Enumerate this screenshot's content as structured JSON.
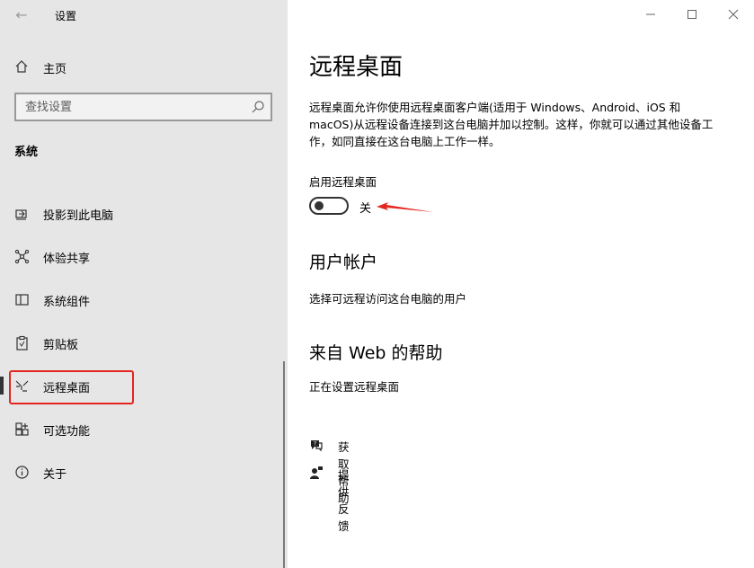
{
  "window": {
    "title": "设置",
    "back_glyph": "←",
    "controls": [
      "minimize-icon",
      "maximize-icon",
      "close-icon"
    ]
  },
  "sidebar": {
    "home_label": "主页",
    "search_placeholder": "查找设置",
    "section": "系统",
    "items": [
      {
        "label": "投影到此电脑",
        "icon": "projector-icon"
      },
      {
        "label": "体验共享",
        "icon": "share-icon"
      },
      {
        "label": "系统组件",
        "icon": "components-icon"
      },
      {
        "label": "剪贴板",
        "icon": "clipboard-icon"
      },
      {
        "label": "远程桌面",
        "icon": "remote-desktop-icon",
        "selected": true
      },
      {
        "label": "可选功能",
        "icon": "optional-features-icon"
      },
      {
        "label": "关于",
        "icon": "info-icon"
      }
    ]
  },
  "main": {
    "title": "远程桌面",
    "description": "远程桌面允许你使用远程桌面客户端(适用于 Windows、Android、iOS 和 macOS)从远程设备连接到这台电脑并加以控制。这样，你就可以通过其他设备工作，如同直接在这台电脑上工作一样。",
    "toggle_label": "启用远程桌面",
    "toggle_state": "关",
    "toggle_on": false,
    "user_accounts_heading": "用户帐户",
    "user_accounts_link": "选择可远程访问这台电脑的用户",
    "help_heading": "来自 Web 的帮助",
    "help_link": "正在设置远程桌面",
    "get_help": "获取帮助",
    "feedback": "提供反馈"
  },
  "colors": {
    "sidebar_bg": "#e6e6e6",
    "highlight": "#e5251f",
    "arrow": "#e5251f"
  }
}
